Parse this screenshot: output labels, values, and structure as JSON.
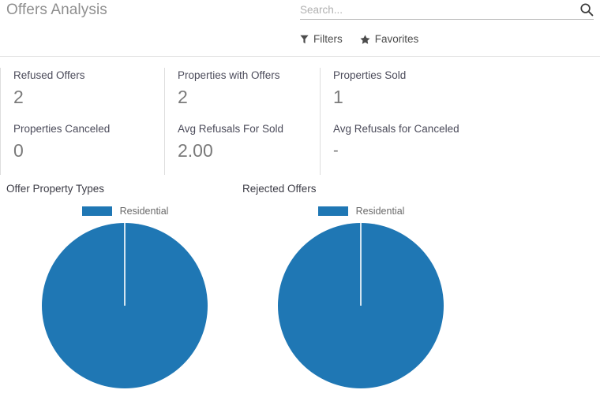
{
  "header": {
    "breadcrumb": "Offers Analysis",
    "search": {
      "placeholder": "Search...",
      "value": "",
      "icon": "search-icon"
    },
    "menus": [
      {
        "label": "Filters",
        "icon": "filter-funnel-icon"
      },
      {
        "label": "Favorites",
        "icon": "star-icon"
      }
    ]
  },
  "tiles": [
    {
      "label": "Refused Offers",
      "value": "2"
    },
    {
      "label": "Properties with Offers",
      "value": "2"
    },
    {
      "label": "Properties Sold",
      "value": "1"
    },
    {
      "label": "Properties Canceled",
      "value": "0"
    },
    {
      "label": "Avg Refusals For Sold",
      "value": "2.00"
    },
    {
      "label": "Avg Refusals for Canceled",
      "value": "-"
    }
  ],
  "colors": {
    "series_blue": "#1f77b4",
    "slice_border": "#ffffff",
    "divider": "#dedede",
    "header_border": "#e0e0e0",
    "breadcrumb_text": "#8f8f8f",
    "tile_value_text": "#7a7a7a"
  },
  "chart_data": [
    {
      "type": "pie",
      "title": "Offer Property Types",
      "categories": [
        "Residential"
      ],
      "values": [
        100
      ],
      "legend": [
        "Residential"
      ],
      "legend_position": "top",
      "colors": [
        "#1f77b4"
      ]
    },
    {
      "type": "pie",
      "title": "Rejected Offers",
      "categories": [
        "Residential"
      ],
      "values": [
        100
      ],
      "legend": [
        "Residential"
      ],
      "legend_position": "top",
      "colors": [
        "#1f77b4"
      ]
    }
  ]
}
